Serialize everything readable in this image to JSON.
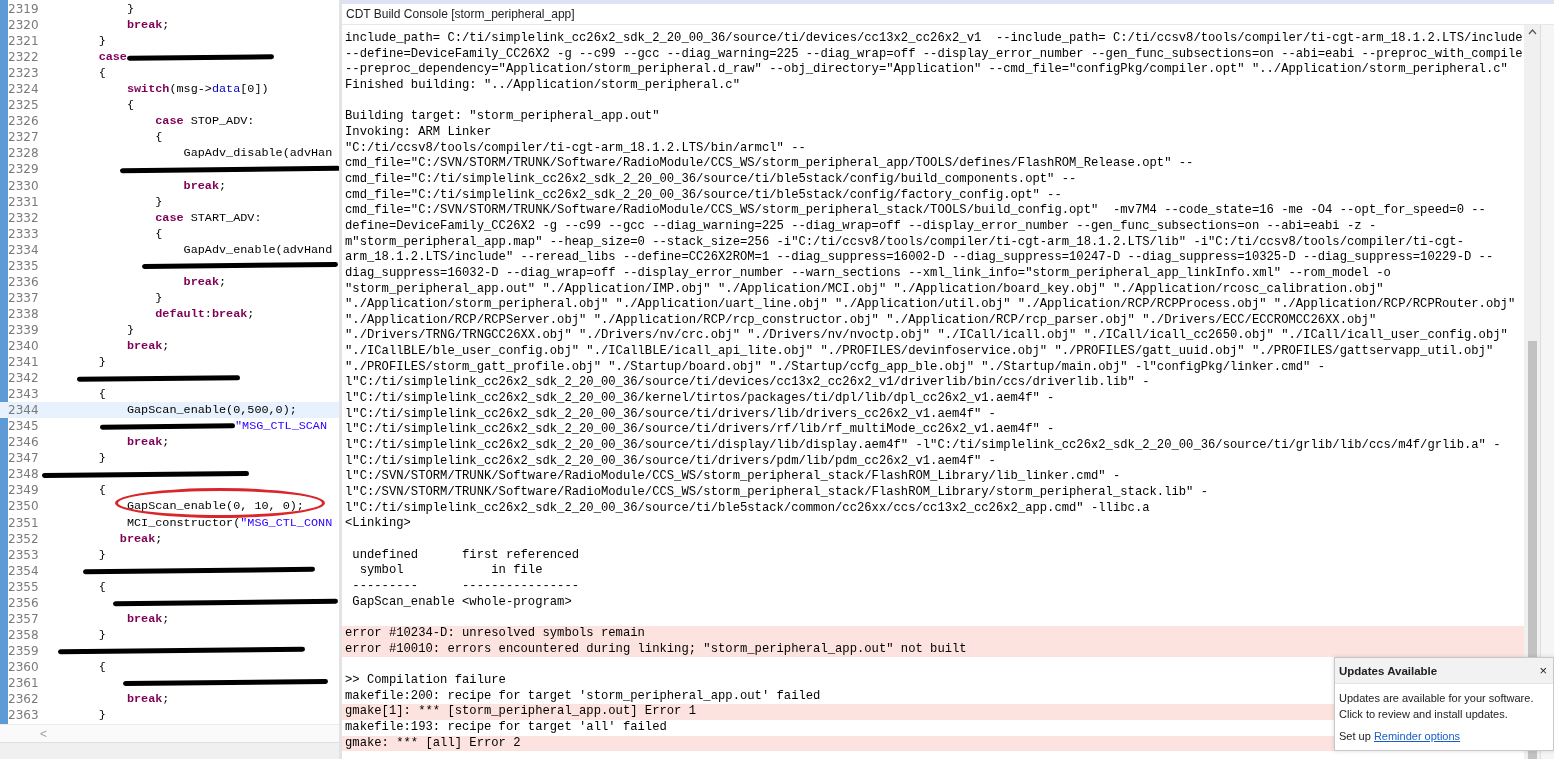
{
  "editor": {
    "lines": [
      {
        "number": "2319",
        "tokens": [
          {
            "kind": "plain",
            "text": "            }"
          }
        ]
      },
      {
        "number": "2320",
        "tokens": [
          {
            "kind": "keyword",
            "text": "            break"
          },
          {
            "kind": "plain",
            "text": ";"
          }
        ]
      },
      {
        "number": "2321",
        "tokens": [
          {
            "kind": "plain",
            "text": "        }"
          }
        ]
      },
      {
        "number": "2322",
        "tokens": [
          {
            "kind": "keyword",
            "text": "        case"
          },
          {
            "kind": "scribble_after"
          }
        ]
      },
      {
        "number": "2323",
        "tokens": [
          {
            "kind": "plain",
            "text": "        {"
          }
        ]
      },
      {
        "number": "2324",
        "tokens": [
          {
            "kind": "keyword",
            "text": "            switch"
          },
          {
            "kind": "plain",
            "text": "(msg->"
          },
          {
            "kind": "field",
            "text": "data"
          },
          {
            "kind": "plain",
            "text": "[0])"
          }
        ]
      },
      {
        "number": "2325",
        "tokens": [
          {
            "kind": "plain",
            "text": "            {"
          }
        ]
      },
      {
        "number": "2326",
        "tokens": [
          {
            "kind": "keyword",
            "text": "                case"
          },
          {
            "kind": "plain",
            "text": " STOP_ADV:"
          }
        ]
      },
      {
        "number": "2327",
        "tokens": [
          {
            "kind": "plain",
            "text": "                {"
          }
        ]
      },
      {
        "number": "2328",
        "tokens": [
          {
            "kind": "plain",
            "text": "                    GapAdv_disable(advHan"
          }
        ]
      },
      {
        "number": "2329",
        "tokens": [
          {
            "kind": "scribble_deep"
          }
        ]
      },
      {
        "number": "2330",
        "tokens": [
          {
            "kind": "keyword",
            "text": "                    break"
          },
          {
            "kind": "plain",
            "text": ";"
          }
        ]
      },
      {
        "number": "2331",
        "tokens": [
          {
            "kind": "plain",
            "text": "                }"
          }
        ]
      },
      {
        "number": "2332",
        "tokens": [
          {
            "kind": "keyword",
            "text": "                case"
          },
          {
            "kind": "plain",
            "text": " START_ADV:"
          }
        ]
      },
      {
        "number": "2333",
        "tokens": [
          {
            "kind": "plain",
            "text": "                {"
          }
        ]
      },
      {
        "number": "2334",
        "tokens": [
          {
            "kind": "plain",
            "text": "                    GapAdv_enable(advHand"
          }
        ]
      },
      {
        "number": "2335",
        "tokens": [
          {
            "kind": "scribble_deeper"
          }
        ]
      },
      {
        "number": "2336",
        "tokens": [
          {
            "kind": "keyword",
            "text": "                    break"
          },
          {
            "kind": "plain",
            "text": ";"
          }
        ]
      },
      {
        "number": "2337",
        "tokens": [
          {
            "kind": "plain",
            "text": "                }"
          }
        ]
      },
      {
        "number": "2338",
        "tokens": [
          {
            "kind": "keyword",
            "text": "                default"
          },
          {
            "kind": "plain",
            "text": ":"
          },
          {
            "kind": "keyword",
            "text": "break"
          },
          {
            "kind": "plain",
            "text": ";"
          }
        ]
      },
      {
        "number": "2339",
        "tokens": [
          {
            "kind": "plain",
            "text": "            }"
          }
        ]
      },
      {
        "number": "2340",
        "tokens": [
          {
            "kind": "keyword",
            "text": "            break"
          },
          {
            "kind": "plain",
            "text": ";"
          }
        ]
      },
      {
        "number": "2341",
        "tokens": [
          {
            "kind": "plain",
            "text": "        }"
          }
        ]
      },
      {
        "number": "2342",
        "tokens": [
          {
            "kind": "scribble_shallow"
          }
        ]
      },
      {
        "number": "2343",
        "tokens": [
          {
            "kind": "plain",
            "text": "        {"
          }
        ]
      },
      {
        "number": "2344",
        "current": true,
        "tokens": [
          {
            "kind": "plain",
            "text": "            GapScan_enable(0,500,0);"
          }
        ]
      },
      {
        "number": "2345",
        "tokens": [
          {
            "kind": "scribble_lead"
          },
          {
            "kind": "string",
            "text": "\"MSG_CTL_SCAN"
          }
        ]
      },
      {
        "number": "2346",
        "tokens": [
          {
            "kind": "keyword",
            "text": "            break"
          },
          {
            "kind": "plain",
            "text": ";"
          }
        ]
      },
      {
        "number": "2347",
        "tokens": [
          {
            "kind": "plain",
            "text": "        }"
          }
        ]
      },
      {
        "number": "2348",
        "tokens": [
          {
            "kind": "scribble_margin"
          }
        ]
      },
      {
        "number": "2349",
        "tokens": [
          {
            "kind": "plain",
            "text": "        {"
          }
        ]
      },
      {
        "number": "2350",
        "circled": true,
        "tokens": [
          {
            "kind": "plain",
            "text": "            GapScan_enable(0, 10, 0);"
          }
        ]
      },
      {
        "number": "2351",
        "tokens": [
          {
            "kind": "plain",
            "text": "            MCI_constructor("
          },
          {
            "kind": "string",
            "text": "\"MSG_CTL_CONN"
          }
        ]
      },
      {
        "number": "2352",
        "tokens": [
          {
            "kind": "keyword",
            "text": "           break"
          },
          {
            "kind": "plain",
            "text": ";"
          }
        ]
      },
      {
        "number": "2353",
        "tokens": [
          {
            "kind": "plain",
            "text": "        }"
          }
        ]
      },
      {
        "number": "2354",
        "tokens": [
          {
            "kind": "scribble_label"
          }
        ]
      },
      {
        "number": "2355",
        "tokens": [
          {
            "kind": "plain",
            "text": "        {"
          }
        ]
      },
      {
        "number": "2356",
        "tokens": [
          {
            "kind": "scribble_call"
          }
        ]
      },
      {
        "number": "2357",
        "tokens": [
          {
            "kind": "keyword",
            "text": "            break"
          },
          {
            "kind": "plain",
            "text": ";"
          }
        ]
      },
      {
        "number": "2358",
        "tokens": [
          {
            "kind": "plain",
            "text": "        }"
          }
        ]
      },
      {
        "number": "2359",
        "tokens": [
          {
            "kind": "scribble_wide"
          }
        ]
      },
      {
        "number": "2360",
        "tokens": [
          {
            "kind": "plain",
            "text": "        {"
          }
        ]
      },
      {
        "number": "2361",
        "tokens": [
          {
            "kind": "scribble_inner"
          }
        ]
      },
      {
        "number": "2362",
        "tokens": [
          {
            "kind": "keyword",
            "text": "            break"
          },
          {
            "kind": "plain",
            "text": ";"
          }
        ]
      },
      {
        "number": "2363",
        "tokens": [
          {
            "kind": "plain",
            "text": "        }"
          }
        ]
      }
    ],
    "scroll_left": "<"
  },
  "console": {
    "title": "CDT Build Console [storm_peripheral_app]",
    "lines": [
      {
        "kind": "normal",
        "text": "include_path= C:/ti/simplelink_cc26x2_sdk_2_20_00_36/source/ti/devices/cc13x2_cc26x2_v1  --include_path= C:/ti/ccsv8/tools/compiler/ti-cgt-arm_18.1.2.LTS/include"
      },
      {
        "kind": "normal",
        "text": "--define=DeviceFamily_CC26X2 -g --c99 --gcc --diag_warning=225 --diag_wrap=off --display_error_number --gen_func_subsections=on --abi=eabi --preproc_with_compile"
      },
      {
        "kind": "normal",
        "text": "--preproc_dependency=\"Application/storm_peripheral.d_raw\" --obj_directory=\"Application\" --cmd_file=\"configPkg/compiler.opt\" \"../Application/storm_peripheral.c\""
      },
      {
        "kind": "normal",
        "text": "Finished building: \"../Application/storm_peripheral.c\""
      },
      {
        "kind": "blank"
      },
      {
        "kind": "normal",
        "text": "Building target: \"storm_peripheral_app.out\""
      },
      {
        "kind": "normal",
        "text": "Invoking: ARM Linker"
      },
      {
        "kind": "normal",
        "text": "\"C:/ti/ccsv8/tools/compiler/ti-cgt-arm_18.1.2.LTS/bin/armcl\" --"
      },
      {
        "kind": "normal",
        "text": "cmd_file=\"C:/SVN/STORM/TRUNK/Software/RadioModule/CCS_WS/storm_peripheral_app/TOOLS/defines/FlashROM_Release.opt\" --"
      },
      {
        "kind": "normal",
        "text": "cmd_file=\"C:/ti/simplelink_cc26x2_sdk_2_20_00_36/source/ti/ble5stack/config/build_components.opt\" --"
      },
      {
        "kind": "normal",
        "text": "cmd_file=\"C:/ti/simplelink_cc26x2_sdk_2_20_00_36/source/ti/ble5stack/config/factory_config.opt\" --"
      },
      {
        "kind": "normal",
        "text": "cmd_file=\"C:/SVN/STORM/TRUNK/Software/RadioModule/CCS_WS/storm_peripheral_stack/TOOLS/build_config.opt\"  -mv7M4 --code_state=16 -me -O4 --opt_for_speed=0 --"
      },
      {
        "kind": "normal",
        "text": "define=DeviceFamily_CC26X2 -g --c99 --gcc --diag_warning=225 --diag_wrap=off --display_error_number --gen_func_subsections=on --abi=eabi -z -"
      },
      {
        "kind": "normal",
        "text": "m\"storm_peripheral_app.map\" --heap_size=0 --stack_size=256 -i\"C:/ti/ccsv8/tools/compiler/ti-cgt-arm_18.1.2.LTS/lib\" -i\"C:/ti/ccsv8/tools/compiler/ti-cgt-"
      },
      {
        "kind": "normal",
        "text": "arm_18.1.2.LTS/include\" --reread_libs --define=CC26X2ROM=1 --diag_suppress=16002-D --diag_suppress=10247-D --diag_suppress=10325-D --diag_suppress=10229-D --"
      },
      {
        "kind": "normal",
        "text": "diag_suppress=16032-D --diag_wrap=off --display_error_number --warn_sections --xml_link_info=\"storm_peripheral_app_linkInfo.xml\" --rom_model -o"
      },
      {
        "kind": "normal",
        "text": "\"storm_peripheral_app.out\" \"./Application/IMP.obj\" \"./Application/MCI.obj\" \"./Application/board_key.obj\" \"./Application/rcosc_calibration.obj\""
      },
      {
        "kind": "normal",
        "text": "\"./Application/storm_peripheral.obj\" \"./Application/uart_line.obj\" \"./Application/util.obj\" \"./Application/RCP/RCPProcess.obj\" \"./Application/RCP/RCPRouter.obj\""
      },
      {
        "kind": "normal",
        "text": "\"./Application/RCP/RCPServer.obj\" \"./Application/RCP/rcp_constructor.obj\" \"./Application/RCP/rcp_parser.obj\" \"./Drivers/ECC/ECCROMCC26XX.obj\""
      },
      {
        "kind": "normal",
        "text": "\"./Drivers/TRNG/TRNGCC26XX.obj\" \"./Drivers/nv/crc.obj\" \"./Drivers/nv/nvoctp.obj\" \"./ICall/icall.obj\" \"./ICall/icall_cc2650.obj\" \"./ICall/icall_user_config.obj\""
      },
      {
        "kind": "normal",
        "text": "\"./ICallBLE/ble_user_config.obj\" \"./ICallBLE/icall_api_lite.obj\" \"./PROFILES/devinfoservice.obj\" \"./PROFILES/gatt_uuid.obj\" \"./PROFILES/gattservapp_util.obj\""
      },
      {
        "kind": "normal",
        "text": "\"./PROFILES/storm_gatt_profile.obj\" \"./Startup/board.obj\" \"./Startup/ccfg_app_ble.obj\" \"./Startup/main.obj\" -l\"configPkg/linker.cmd\" -"
      },
      {
        "kind": "normal",
        "text": "l\"C:/ti/simplelink_cc26x2_sdk_2_20_00_36/source/ti/devices/cc13x2_cc26x2_v1/driverlib/bin/ccs/driverlib.lib\" -"
      },
      {
        "kind": "normal",
        "text": "l\"C:/ti/simplelink_cc26x2_sdk_2_20_00_36/kernel/tirtos/packages/ti/dpl/lib/dpl_cc26x2_v1.aem4f\" -"
      },
      {
        "kind": "normal",
        "text": "l\"C:/ti/simplelink_cc26x2_sdk_2_20_00_36/source/ti/drivers/lib/drivers_cc26x2_v1.aem4f\" -"
      },
      {
        "kind": "normal",
        "text": "l\"C:/ti/simplelink_cc26x2_sdk_2_20_00_36/source/ti/drivers/rf/lib/rf_multiMode_cc26x2_v1.aem4f\" -"
      },
      {
        "kind": "normal",
        "text": "l\"C:/ti/simplelink_cc26x2_sdk_2_20_00_36/source/ti/display/lib/display.aem4f\" -l\"C:/ti/simplelink_cc26x2_sdk_2_20_00_36/source/ti/grlib/lib/ccs/m4f/grlib.a\" -"
      },
      {
        "kind": "normal",
        "text": "l\"C:/ti/simplelink_cc26x2_sdk_2_20_00_36/source/ti/drivers/pdm/lib/pdm_cc26x2_v1.aem4f\" -"
      },
      {
        "kind": "normal",
        "text": "l\"C:/SVN/STORM/TRUNK/Software/RadioModule/CCS_WS/storm_peripheral_stack/FlashROM_Library/lib_linker.cmd\" -"
      },
      {
        "kind": "normal",
        "text": "l\"C:/SVN/STORM/TRUNK/Software/RadioModule/CCS_WS/storm_peripheral_stack/FlashROM_Library/storm_peripheral_stack.lib\" -"
      },
      {
        "kind": "normal",
        "text": "l\"C:/ti/simplelink_cc26x2_sdk_2_20_00_36/source/ti/ble5stack/common/cc26xx/ccs/cc13x2_cc26x2_app.cmd\" -llibc.a"
      },
      {
        "kind": "normal",
        "text": "<Linking>"
      },
      {
        "kind": "blank"
      },
      {
        "kind": "normal",
        "text": " undefined      first referenced"
      },
      {
        "kind": "normal",
        "text": "  symbol            in file"
      },
      {
        "kind": "normal",
        "text": " ---------      ----------------"
      },
      {
        "kind": "normal",
        "text": " GapScan_enable <whole-program>"
      },
      {
        "kind": "blank"
      },
      {
        "kind": "error",
        "text": "error #10234-D: unresolved symbols remain"
      },
      {
        "kind": "error",
        "text": "error #10010: errors encountered during linking; \"storm_peripheral_app.out\" not built"
      },
      {
        "kind": "blank"
      },
      {
        "kind": "normal",
        "text": ">> Compilation failure"
      },
      {
        "kind": "normal",
        "text": "makefile:200: recipe for target 'storm_peripheral_app.out' failed"
      },
      {
        "kind": "error",
        "text": "gmake[1]: *** [storm_peripheral_app.out] Error 1"
      },
      {
        "kind": "normal",
        "text": "makefile:193: recipe for target 'all' failed"
      },
      {
        "kind": "error",
        "text": "gmake: *** [all] Error 2"
      }
    ]
  },
  "notification": {
    "title": "Updates Available",
    "close": "×",
    "body": "Updates are available for your software. Click to review and install updates.",
    "footer": "Set up",
    "link": "Reminder options"
  }
}
